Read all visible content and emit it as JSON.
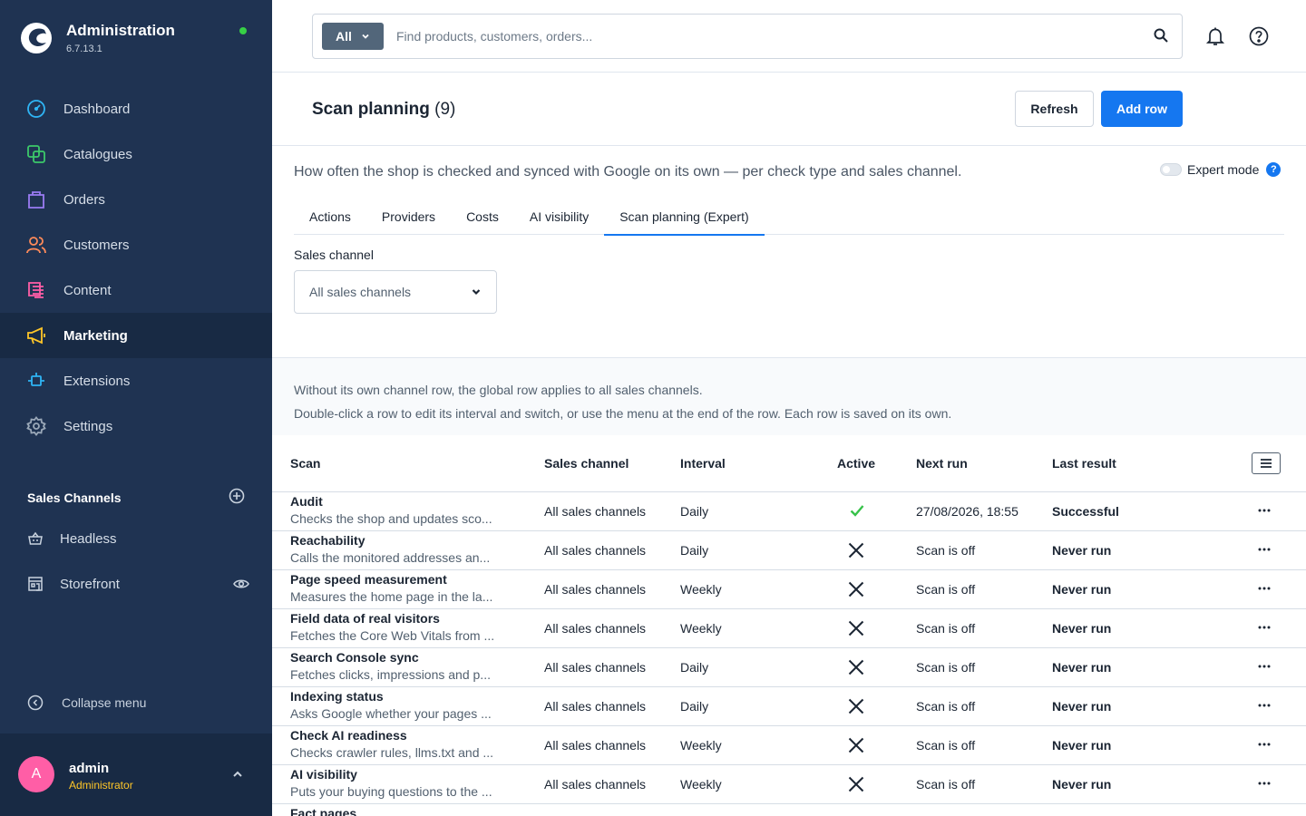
{
  "app": {
    "title": "Administration",
    "version": "6.7.13.1"
  },
  "nav": [
    {
      "label": "Dashboard",
      "icon": "dashboard-icon",
      "color": "#2fb5f5"
    },
    {
      "label": "Catalogues",
      "icon": "catalogue-icon",
      "color": "#3cc96a"
    },
    {
      "label": "Orders",
      "icon": "orders-icon",
      "color": "#9a7cf3"
    },
    {
      "label": "Customers",
      "icon": "customers-icon",
      "color": "#ff8b5a"
    },
    {
      "label": "Content",
      "icon": "content-icon",
      "color": "#ff5ea6"
    },
    {
      "label": "Marketing",
      "icon": "marketing-icon",
      "color": "#ffc628",
      "active": true
    },
    {
      "label": "Extensions",
      "icon": "extensions-icon",
      "color": "#2fb5f5"
    },
    {
      "label": "Settings",
      "icon": "settings-icon",
      "color": "#9aa8b8"
    }
  ],
  "sales_channels": {
    "heading": "Sales Channels",
    "items": [
      {
        "label": "Headless"
      },
      {
        "label": "Storefront"
      }
    ]
  },
  "collapse_label": "Collapse menu",
  "user": {
    "name": "admin",
    "role": "Administrator",
    "initial": "A"
  },
  "search": {
    "scope": "All",
    "placeholder": "Find products, customers, orders..."
  },
  "page": {
    "title": "Scan planning",
    "count": "(9)",
    "refresh_label": "Refresh",
    "add_label": "Add row",
    "description": "How often the shop is checked and synced with Google on its own — per check type and sales channel.",
    "expert_label": "Expert mode",
    "expert_help": "?"
  },
  "tabs": [
    {
      "label": "Actions"
    },
    {
      "label": "Providers"
    },
    {
      "label": "Costs"
    },
    {
      "label": "AI visibility"
    },
    {
      "label": "Scan planning (Expert)",
      "active": true
    }
  ],
  "filter": {
    "label": "Sales channel",
    "value": "All sales channels"
  },
  "info": {
    "line1": "Without its own channel row, the global row applies to all sales channels.",
    "line2": "Double-click a row to edit its interval and switch, or use the menu at the end of the row. Each row is saved on its own."
  },
  "table": {
    "columns": {
      "scan": "Scan",
      "channel": "Sales channel",
      "interval": "Interval",
      "active": "Active",
      "next": "Next run",
      "last": "Last result"
    },
    "rows": [
      {
        "name": "Audit",
        "desc": "Checks the shop and updates sco...",
        "channel": "All sales channels",
        "interval": "Daily",
        "active": true,
        "next": "27/08/2026, 18:55",
        "last": "Successful"
      },
      {
        "name": "Reachability",
        "desc": "Calls the monitored addresses an...",
        "channel": "All sales channels",
        "interval": "Daily",
        "active": false,
        "next": "Scan is off",
        "last": "Never run"
      },
      {
        "name": "Page speed measurement",
        "desc": "Measures the home page in the la...",
        "channel": "All sales channels",
        "interval": "Weekly",
        "active": false,
        "next": "Scan is off",
        "last": "Never run"
      },
      {
        "name": "Field data of real visitors",
        "desc": "Fetches the Core Web Vitals from ...",
        "channel": "All sales channels",
        "interval": "Weekly",
        "active": false,
        "next": "Scan is off",
        "last": "Never run"
      },
      {
        "name": "Search Console sync",
        "desc": "Fetches clicks, impressions and p...",
        "channel": "All sales channels",
        "interval": "Daily",
        "active": false,
        "next": "Scan is off",
        "last": "Never run"
      },
      {
        "name": "Indexing status",
        "desc": "Asks Google whether your pages ...",
        "channel": "All sales channels",
        "interval": "Daily",
        "active": false,
        "next": "Scan is off",
        "last": "Never run"
      },
      {
        "name": "Check AI readiness",
        "desc": "Checks crawler rules, llms.txt and ...",
        "channel": "All sales channels",
        "interval": "Weekly",
        "active": false,
        "next": "Scan is off",
        "last": "Never run"
      },
      {
        "name": "AI visibility",
        "desc": "Puts your buying questions to the ...",
        "channel": "All sales channels",
        "interval": "Weekly",
        "active": false,
        "next": "Scan is off",
        "last": "Never run"
      },
      {
        "name": "Fact pages",
        "desc": "",
        "channel": "",
        "interval": "",
        "active": null,
        "next": "",
        "last": ""
      }
    ]
  },
  "colors": {
    "sidebar": "#1f3352",
    "accent": "#1577f0",
    "success": "#37c24a"
  }
}
